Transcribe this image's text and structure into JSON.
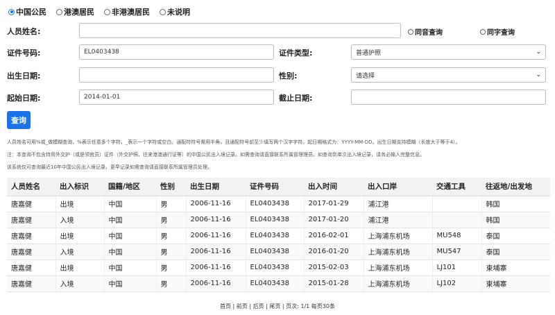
{
  "nationality_options": [
    {
      "label": "中国公民",
      "checked": true
    },
    {
      "label": "港澳居民",
      "checked": false
    },
    {
      "label": "非港澳居民",
      "checked": false
    },
    {
      "label": "未说明",
      "checked": false
    }
  ],
  "form": {
    "name_label": "人员姓名:",
    "name_value": "",
    "same_sound": "同音查询",
    "same_char": "同字查询",
    "id_label": "证件号码:",
    "id_value": "EL0403438",
    "id_type_label": "证件类型:",
    "id_type_value": "普通护照",
    "birth_label": "出生日期:",
    "birth_value": "",
    "gender_label": "性别:",
    "gender_value": "请选择",
    "start_label": "起始日期:",
    "start_value": "2014-01-01",
    "end_label": "截止日期:",
    "end_value": ""
  },
  "search_button": "查询",
  "notes": [
    "人员姓名可用%或_做模糊查询，%表示任意多个字符，_表示一个字符或空白。通配符符号需用半角，且通配符号前至少填写两个汉字字符。起日期格式为：YYYY-MM-DD。出生日期支持模糊（长度大于等于4）。",
    "注：本查询不包含持用外交护（或是领官员）证件（外交护照、往来港澳通行证等）的中国公民出入境记录。如需查询请直接联系所属管理理员。如查询到单次出入境记录，请务必输入完整信息。",
    "该系统仅可查询最近10年中国公民出入境记录，更早记录如需查询请直接联系所属管理员处理。"
  ],
  "table": {
    "headers": [
      "人员姓名",
      "出入标识",
      "国籍/地区",
      "性别",
      "出生日期",
      "证件号码",
      "出入时间",
      "出入口岸",
      "交通工具",
      "往返地/出发地"
    ],
    "rows": [
      [
        "唐嘉健",
        "出境",
        "中国",
        "男",
        "2006-11-16",
        "EL0403438",
        "2017-01-29",
        "浦江港",
        "",
        "韩国"
      ],
      [
        "唐嘉健",
        "入境",
        "中国",
        "男",
        "2006-11-16",
        "EL0403438",
        "2017-01-20",
        "浦江港",
        "",
        "韩国"
      ],
      [
        "唐嘉健",
        "出境",
        "中国",
        "男",
        "2006-11-16",
        "EL0403438",
        "2016-02-01",
        "上海浦东机场",
        "MU548",
        "泰国"
      ],
      [
        "唐嘉健",
        "入境",
        "中国",
        "男",
        "2006-11-16",
        "EL0403438",
        "2016-01-20",
        "上海浦东机场",
        "MU547",
        "泰国"
      ],
      [
        "唐嘉健",
        "出境",
        "中国",
        "男",
        "2006-11-16",
        "EL0403438",
        "2015-02-03",
        "上海浦东机场",
        "LJ101",
        "柬埔寨"
      ],
      [
        "唐嘉健",
        "入境",
        "中国",
        "男",
        "2006-11-16",
        "EL0403438",
        "2015-01-28",
        "上海浦东机场",
        "LJ102",
        "柬埔寨"
      ]
    ]
  },
  "pager": {
    "first": "首页",
    "prev": "前页",
    "next": "后页",
    "last": "尾页",
    "info": "页次: 1/1 每页30条"
  }
}
